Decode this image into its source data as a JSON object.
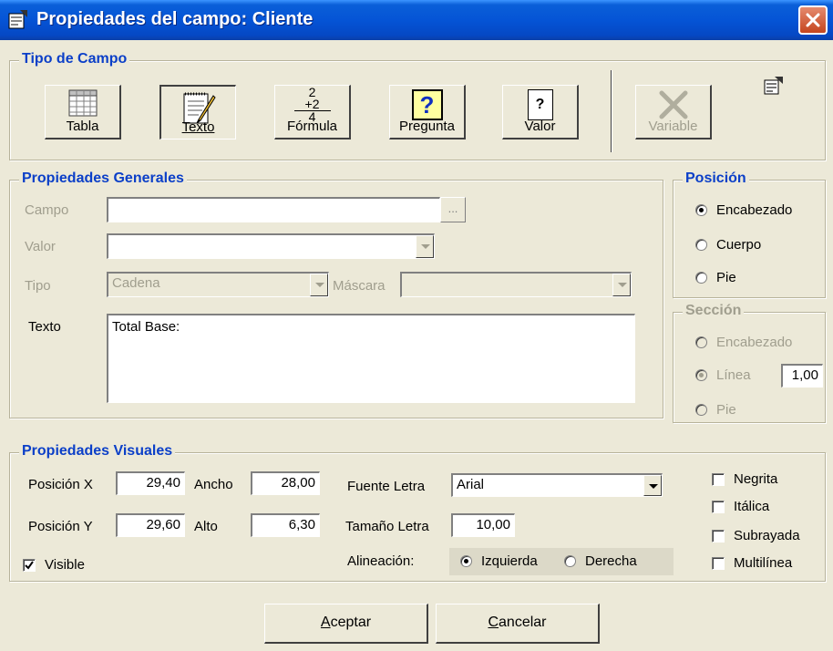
{
  "window": {
    "title": "Propiedades del campo: Cliente",
    "icons": [
      "properties-icon",
      "close-icon"
    ]
  },
  "tipo_campo": {
    "legend": "Tipo de Campo",
    "buttons": [
      {
        "label": "Tabla",
        "icon": "table-icon"
      },
      {
        "label": "Texto",
        "icon": "notepad-pen-icon",
        "state": "pressed"
      },
      {
        "label": "Fórmula",
        "icon": "formula-icon",
        "formula_top": "2",
        "formula_mid": "+2",
        "formula_bottom": "4"
      },
      {
        "label": "Pregunta",
        "icon": "question-icon",
        "glyph": "?"
      },
      {
        "label": "Valor",
        "icon": "document-question-icon",
        "glyph": "?"
      },
      {
        "label": "Variable",
        "icon": "x-icon",
        "state": "disabled"
      }
    ],
    "properties_icon": "properties-icon"
  },
  "generales": {
    "legend": "Propiedades Generales",
    "campo_label": "Campo",
    "campo_value": "",
    "campo_button": "...",
    "valor_label": "Valor",
    "valor_value": "",
    "tipo_label": "Tipo",
    "tipo_value": "Cadena",
    "mascara_label": "Máscara",
    "mascara_value": "",
    "texto_label": "Texto",
    "texto_value": "Total Base:"
  },
  "posicion": {
    "legend": "Posición",
    "options": [
      "Encabezado",
      "Cuerpo",
      "Pie"
    ],
    "selected": "Encabezado"
  },
  "seccion": {
    "legend": "Sección",
    "options": [
      "Encabezado",
      "Línea",
      "Pie"
    ],
    "selected": "Línea",
    "linea_value": "1,00"
  },
  "visuales": {
    "legend": "Propiedades Visuales",
    "posx_label": "Posición X",
    "posx_value": "29,40",
    "ancho_label": "Ancho",
    "ancho_value": "28,00",
    "posy_label": "Posición Y",
    "posy_value": "29,60",
    "alto_label": "Alto",
    "alto_value": "6,30",
    "fuente_label": "Fuente Letra",
    "fuente_value": "Arial",
    "tamano_label": "Tamaño Letra",
    "tamano_value": "10,00",
    "alineacion_label": "Alineación:",
    "alineacion_options": [
      "Izquierda",
      "Derecha"
    ],
    "alineacion_selected": "Izquierda",
    "visible_label": "Visible",
    "visible_checked": true,
    "checks": [
      {
        "label": "Negrita",
        "checked": false
      },
      {
        "label": "Itálica",
        "checked": false
      },
      {
        "label": "Subrayada",
        "checked": false
      },
      {
        "label": "Multilínea",
        "checked": false
      }
    ]
  },
  "actions": {
    "aceptar_u": "A",
    "aceptar_rest": "ceptar",
    "cancelar_u": "C",
    "cancelar_rest": "ancelar"
  },
  "colors": {
    "title_bar": "#0554d6",
    "legend_text": "#0b3fc8",
    "window_bg": "#ece9d8",
    "close_button": "#c5451e"
  }
}
